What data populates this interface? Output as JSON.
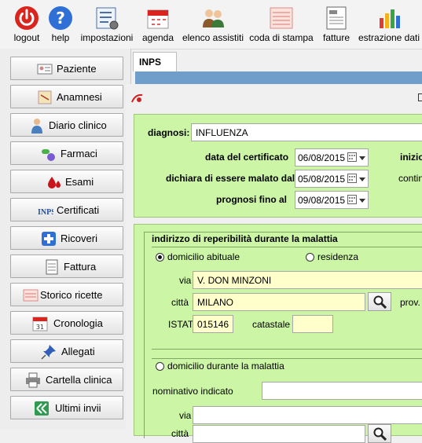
{
  "toolbar": {
    "logout": "logout",
    "help": "help",
    "impostazioni": "impostazioni",
    "agenda": "agenda",
    "elenco_assistiti": "elenco assistiti",
    "coda_di_stampa": "coda di stampa",
    "fatture": "fatture",
    "estrazione_dati": "estrazione dati"
  },
  "sidebar": {
    "items": [
      "Paziente",
      "Anamnesi",
      "Diario clinico",
      "Farmaci",
      "Esami",
      "Certificati",
      "Ricoveri",
      "Fattura",
      "Storico ricette",
      "Cronologia",
      "Allegati",
      "Cartella clinica",
      "Ultimi invii"
    ]
  },
  "tab": {
    "label": "INPS"
  },
  "form": {
    "diagnosi_label": "diagnosi:",
    "diagnosi_value": "INFLUENZA",
    "data_certificato_label": "data del certificato",
    "data_certificato_value": "06/08/2015",
    "malato_dal_label": "dichiara di essere malato dal",
    "malato_dal_value": "05/08/2015",
    "prognosi_label": "prognosi fino al",
    "prognosi_value": "09/08/2015",
    "inizio_label": "inizio",
    "contin_label": "contin",
    "reperibilita_title": "indirizzo di reperibilità durante la malattia",
    "domicilio_abituale": "domicilio abituale",
    "residenza": "residenza",
    "via_label": "via",
    "via_value": "V. DON MINZONI",
    "citta_label": "città",
    "citta_value": "MILANO",
    "prov_label": "prov.",
    "istat_label": "ISTAT",
    "istat_value": "015146",
    "catastale_label": "catastale",
    "catastale_value": "",
    "domicilio_malattia": "domicilio durante la malattia",
    "nominativo_label": "nominativo indicato",
    "via2_label": "via",
    "citta2_label": "città"
  },
  "colors": {
    "panel_green": "#ccf5a6",
    "field_yellow": "#ffffcc",
    "title_blue": "#6e9ec9"
  }
}
